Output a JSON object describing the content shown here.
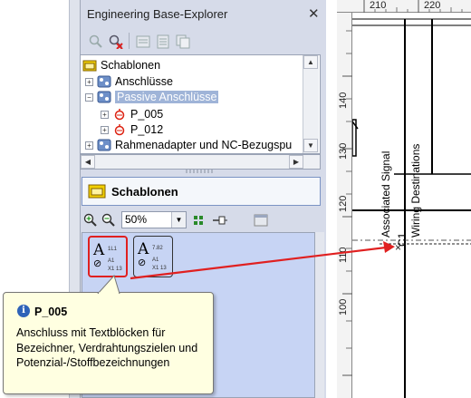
{
  "explorer": {
    "title": "Engineering Base-Explorer",
    "close_symbol": "✕",
    "tree": [
      {
        "label": "Schablonen",
        "icon": "folder-template-icon"
      },
      {
        "label": "Anschlüsse",
        "icon": "connector-group-icon"
      },
      {
        "label": "Passive Anschlüsse",
        "icon": "connector-group-icon",
        "selected": true
      },
      {
        "label": "P_005",
        "icon": "terminal-icon"
      },
      {
        "label": "P_012",
        "icon": "terminal-icon"
      },
      {
        "label": "Rahmenadapter und NC-Bezugspu",
        "icon": "connector-group-icon"
      }
    ],
    "section_title": "Schablonen",
    "zoom_value": "50%",
    "tiles": [
      {
        "A": "A",
        "sub1": "1L1",
        "sub2": "A1",
        "sub3": "X1 13"
      },
      {
        "A": "A",
        "sub1": "7.82",
        "sub2": "A1",
        "sub3": "X1 13"
      }
    ]
  },
  "canvas": {
    "ruler_top": [
      "210",
      "220"
    ],
    "ruler_left": [
      "140",
      "130",
      "120",
      "110",
      "100"
    ],
    "label_associated": "Associated Signal",
    "label_wiring": "Wiring Destinations",
    "label_c1": "C1",
    "symbol_x": "×"
  },
  "tooltip": {
    "title": "P_005",
    "body": "Anschluss mit Textblöcken für Bezeichner, Verdrahtungszielen und Potenzial-/Stoffbezeichnungen"
  },
  "colors": {
    "accent": "#e02020",
    "preview_bg": "#c7d4f4",
    "tooltip_bg": "#ffffe1",
    "selected_bg": "#9fb4d8"
  }
}
